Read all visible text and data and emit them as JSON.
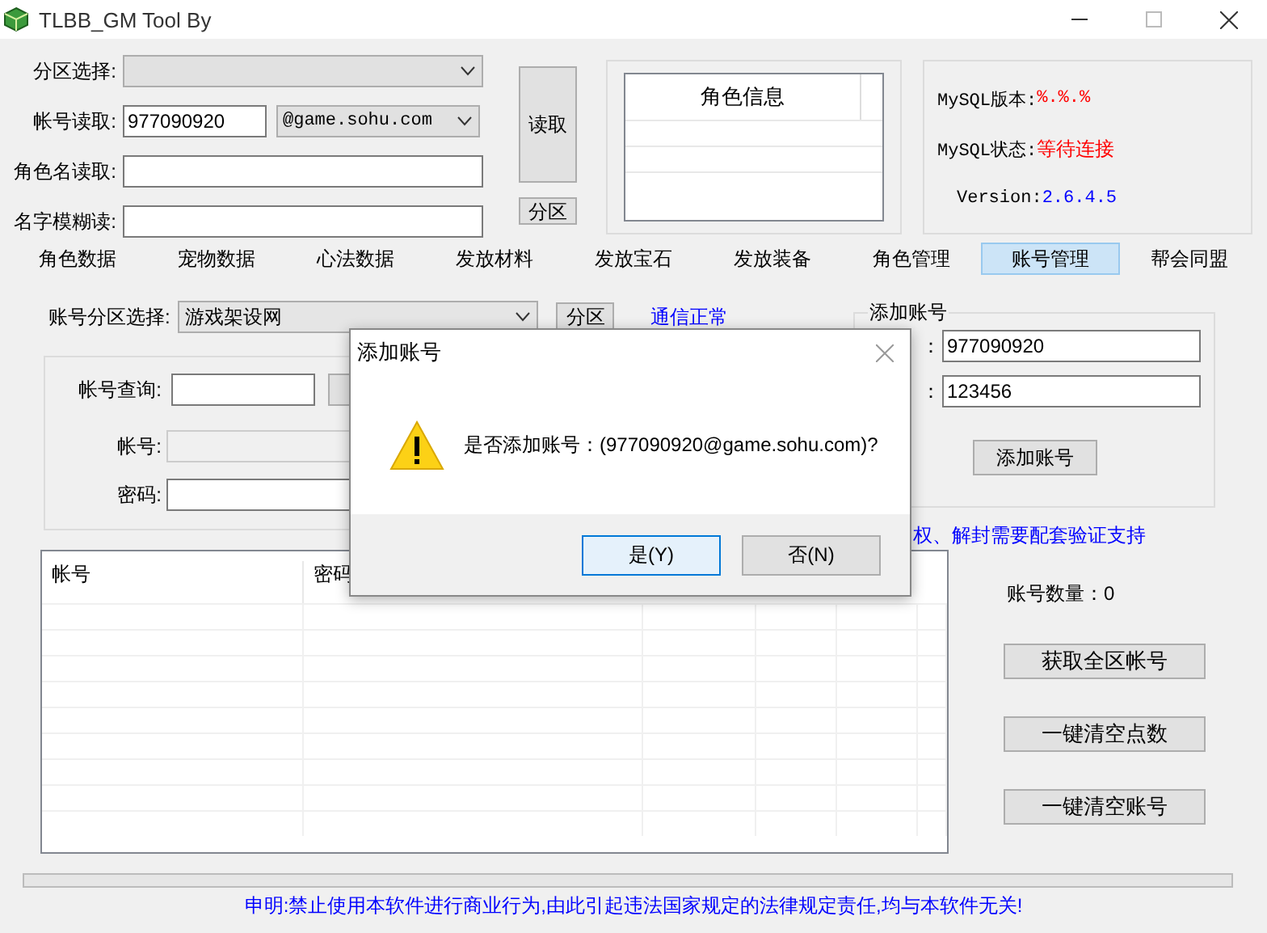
{
  "window": {
    "title": "TLBB_GM Tool By"
  },
  "top_rows": [
    {
      "kind": "combo",
      "label": "分区选择:"
    },
    {
      "kind": "account",
      "label": "帐号读取:",
      "value": "977090920",
      "suffix": "@game.sohu.com"
    },
    {
      "kind": "text",
      "label": "角色名读取:"
    },
    {
      "kind": "text",
      "label": "名字模糊读:"
    }
  ],
  "read_button": "读取",
  "zone_button": "分区",
  "role_info": {
    "header": "角色信息"
  },
  "mysql": [
    {
      "label": "MySQL版本:",
      "value": "%.%.%",
      "color": "#ff0000"
    },
    {
      "label": "MySQL状态:",
      "value": "等待连接",
      "color": "#ff0000"
    },
    {
      "label": "Version:",
      "value": "2.6.4.5",
      "color": "#0000ff"
    }
  ],
  "tabs": [
    {
      "label": "角色数据",
      "selected": false
    },
    {
      "label": "宠物数据",
      "selected": false
    },
    {
      "label": "心法数据",
      "selected": false
    },
    {
      "label": "发放材料",
      "selected": false
    },
    {
      "label": "发放宝石",
      "selected": false
    },
    {
      "label": "发放装备",
      "selected": false
    },
    {
      "label": "角色管理",
      "selected": false
    },
    {
      "label": "账号管理",
      "selected": true
    },
    {
      "label": "帮会同盟",
      "selected": false
    }
  ],
  "account_page": {
    "zone_label": "账号分区选择:",
    "zone_value": "游戏架设网",
    "zone_button": "分区",
    "status_link": "通信正常",
    "query": {
      "label": "帐号查询:",
      "account_label": "帐号:",
      "password_label": "密码:"
    },
    "add": {
      "title": "添加账号",
      "rows": [
        {
          "label": "：",
          "value": "977090920"
        },
        {
          "label": "：",
          "value": "123456"
        }
      ],
      "button": "添加账号"
    },
    "note": "权、解封需要配套验证支持",
    "table": {
      "columns": [
        "帐号",
        "密码"
      ]
    },
    "count": "账号数量：0",
    "buttons": [
      "获取全区帐号",
      "一键清空点数",
      "一键清空账号"
    ]
  },
  "progress": {
    "level": 0
  },
  "footer": "申明:禁止使用本软件进行商业行为,由此引起违法国家规定的法律规定责任,均与本软件无关!",
  "dialog": {
    "title": "添加账号",
    "message": "是否添加账号：(977090920@game.sohu.com)?",
    "buttons": [
      {
        "label": "是(Y)",
        "selected": true
      },
      {
        "label": "否(N)",
        "selected": false
      }
    ]
  }
}
